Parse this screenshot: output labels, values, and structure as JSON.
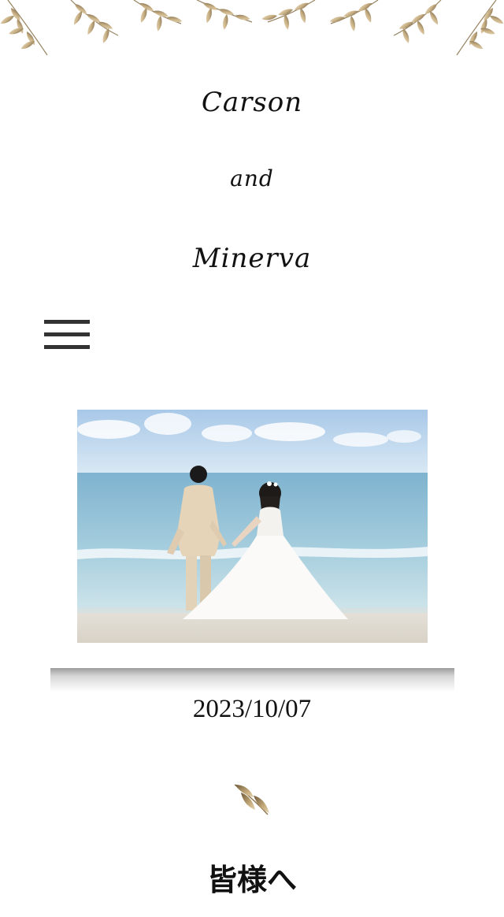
{
  "header": {
    "name_first": "Carson",
    "name_and": "and",
    "name_second": "Minerva"
  },
  "nav": {
    "menu_icon": "hamburger-menu-icon"
  },
  "hero": {
    "photo": "beach-wedding-couple-photo"
  },
  "event": {
    "date": "2023/10/07"
  },
  "sections": {
    "greeting_title": "皆様へ"
  },
  "colors": {
    "gold": "#b49a6a",
    "text": "#111111",
    "menu": "#333333"
  }
}
